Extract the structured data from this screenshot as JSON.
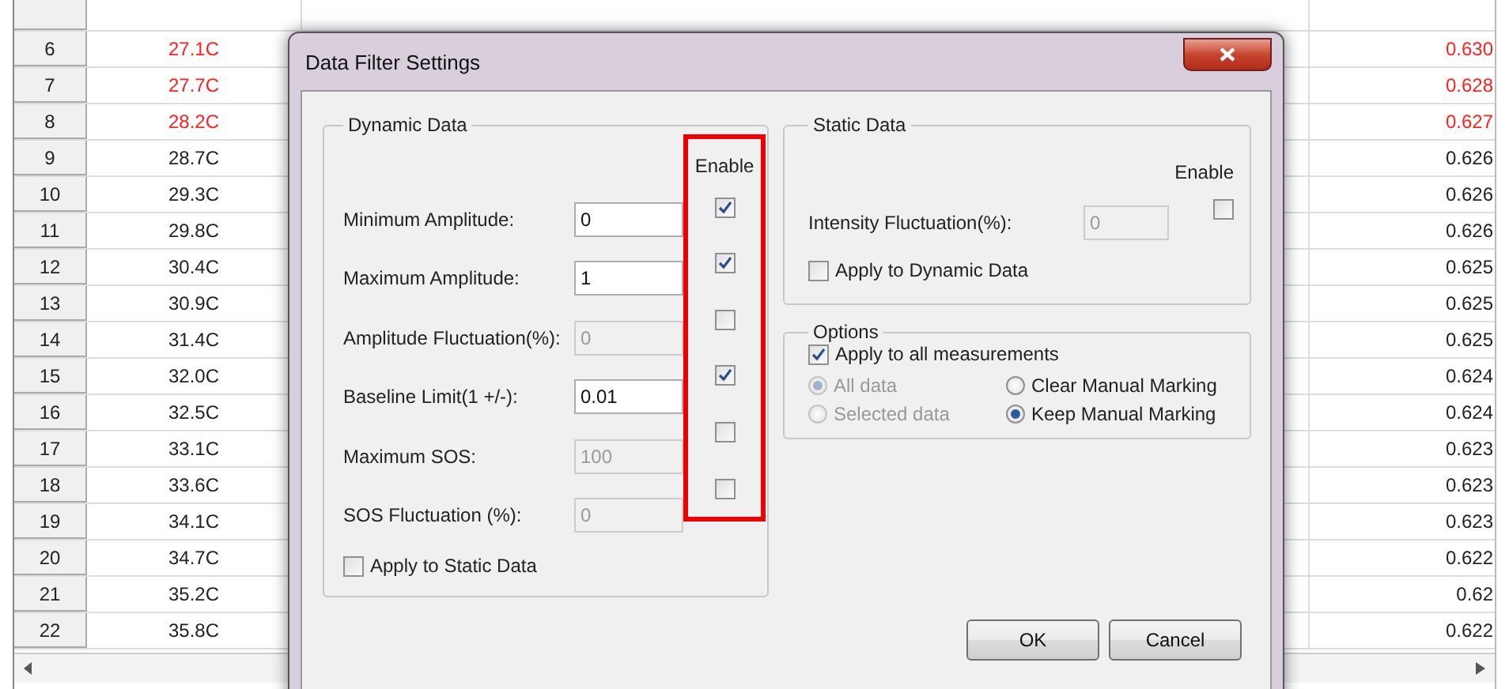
{
  "sheet": {
    "rows": [
      {
        "number": "6",
        "temperature": "27.1C",
        "value": "0.630",
        "alert": true
      },
      {
        "number": "7",
        "temperature": "27.7C",
        "value": "0.628",
        "alert": true
      },
      {
        "number": "8",
        "temperature": "28.2C",
        "value": "0.627",
        "alert": true
      },
      {
        "number": "9",
        "temperature": "28.7C",
        "value": "0.626",
        "alert": false
      },
      {
        "number": "10",
        "temperature": "29.3C",
        "value": "0.626",
        "alert": false
      },
      {
        "number": "11",
        "temperature": "29.8C",
        "value": "0.626",
        "alert": false
      },
      {
        "number": "12",
        "temperature": "30.4C",
        "value": "0.625",
        "alert": false
      },
      {
        "number": "13",
        "temperature": "30.9C",
        "value": "0.625",
        "alert": false
      },
      {
        "number": "14",
        "temperature": "31.4C",
        "value": "0.625",
        "alert": false
      },
      {
        "number": "15",
        "temperature": "32.0C",
        "value": "0.624",
        "alert": false
      },
      {
        "number": "16",
        "temperature": "32.5C",
        "value": "0.624",
        "alert": false
      },
      {
        "number": "17",
        "temperature": "33.1C",
        "value": "0.623",
        "alert": false
      },
      {
        "number": "18",
        "temperature": "33.6C",
        "value": "0.623",
        "alert": false
      },
      {
        "number": "19",
        "temperature": "34.1C",
        "value": "0.623",
        "alert": false
      },
      {
        "number": "20",
        "temperature": "34.7C",
        "value": "0.622",
        "alert": false
      },
      {
        "number": "21",
        "temperature": "35.2C",
        "value": "0.62",
        "alert": false
      },
      {
        "number": "22",
        "temperature": "35.8C",
        "value": "0.622",
        "alert": false
      }
    ]
  },
  "dialog": {
    "title": "Data Filter Settings",
    "dynamic_data": {
      "title": "Dynamic Data",
      "enable_column": {
        "label": "Enable",
        "highlighted": true
      },
      "fields": [
        {
          "label": "Minimum Amplitude:",
          "value": "0",
          "disabled": false,
          "enabled": true
        },
        {
          "label": "Maximum Amplitude:",
          "value": "1",
          "disabled": false,
          "enabled": true
        },
        {
          "label": "Amplitude Fluctuation(%):",
          "value": "0",
          "disabled": true,
          "enabled": false
        },
        {
          "label": "Baseline Limit(1 +/-):",
          "value": "0.01",
          "disabled": false,
          "enabled": true
        },
        {
          "label": "Maximum SOS:",
          "value": "100",
          "disabled": true,
          "enabled": false
        },
        {
          "label": "SOS Fluctuation (%):",
          "value": "0",
          "disabled": true,
          "enabled": false
        }
      ],
      "apply": {
        "label": "Apply to Static Data",
        "checked": false
      }
    },
    "static_data": {
      "title": "Static Data",
      "enable_label": "Enable",
      "field": {
        "label": "Intensity Fluctuation(%):",
        "value": "0",
        "disabled": true,
        "enabled": false
      },
      "apply": {
        "label": "Apply to Dynamic Data",
        "checked": false
      }
    },
    "options": {
      "title": "Options",
      "apply_all": {
        "label": "Apply to all measurements",
        "checked": true
      },
      "radios": [
        {
          "label": "All data",
          "selected": true,
          "disabled": true
        },
        {
          "label": "Clear Manual Marking",
          "selected": false,
          "disabled": false
        },
        {
          "label": "Selected data",
          "selected": false,
          "disabled": true
        },
        {
          "label": "Keep Manual Marking",
          "selected": true,
          "disabled": false
        }
      ]
    },
    "buttons": [
      "OK",
      "Cancel"
    ]
  }
}
